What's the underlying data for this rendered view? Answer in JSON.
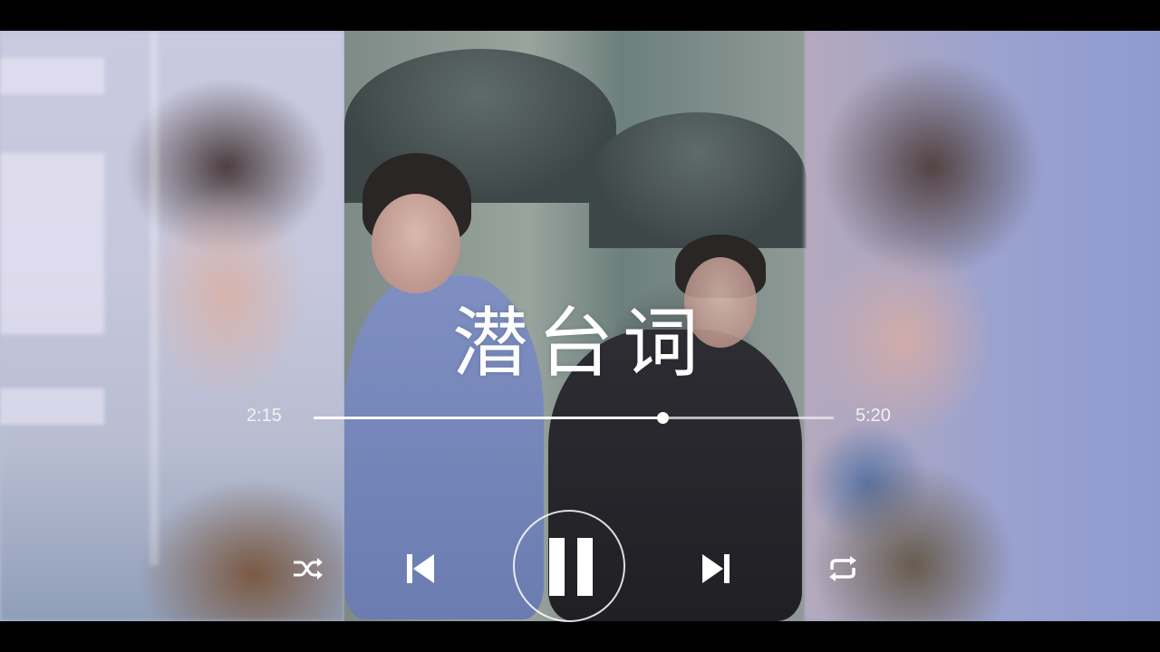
{
  "player": {
    "song_title": "潜台词",
    "current_time": "2:15",
    "total_time": "5:20",
    "progress": 0.67
  },
  "controls": {
    "shuffle": "shuffle-icon",
    "previous": "skip-previous-icon",
    "play_pause": "pause-icon",
    "next": "skip-next-icon",
    "repeat": "repeat-icon"
  },
  "colors": {
    "letterbox": "#000000",
    "overlay_text": "#ffffff"
  }
}
